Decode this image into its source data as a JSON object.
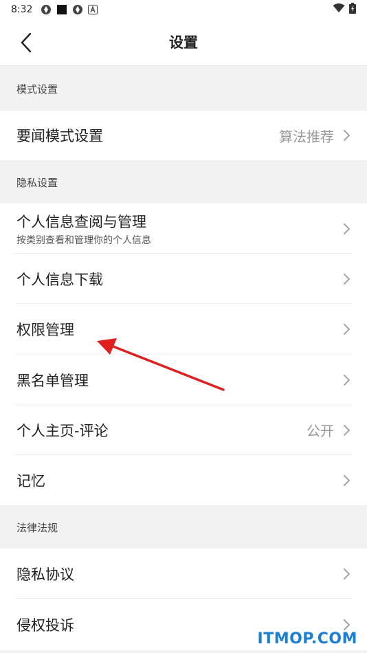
{
  "status_bar": {
    "time": "8:32",
    "icons": [
      "app-icon",
      "square-icon",
      "app-icon",
      "a-icon"
    ],
    "right_icons": [
      "wifi-icon",
      "battery-icon"
    ]
  },
  "header": {
    "title": "设置",
    "back_icon": "chevron-left-icon"
  },
  "sections": {
    "mode": {
      "title": "模式设置",
      "items": [
        {
          "label": "要闻模式设置",
          "value": "算法推荐"
        }
      ]
    },
    "privacy": {
      "title": "隐私设置",
      "items": [
        {
          "label": "个人信息查阅与管理",
          "sub": "按类别查看和管理你的个人信息"
        },
        {
          "label": "个人信息下载"
        },
        {
          "label": "权限管理"
        },
        {
          "label": "黑名单管理"
        },
        {
          "label": "个人主页-评论",
          "value": "公开"
        },
        {
          "label": "记忆"
        }
      ]
    },
    "legal": {
      "title": "法律法规",
      "items": [
        {
          "label": "隐私协议"
        },
        {
          "label": "侵权投诉"
        }
      ]
    }
  },
  "annotation": {
    "color": "#e02020"
  },
  "watermark": {
    "text": "ITMOP.COM",
    "color": "#1a7fd4"
  }
}
